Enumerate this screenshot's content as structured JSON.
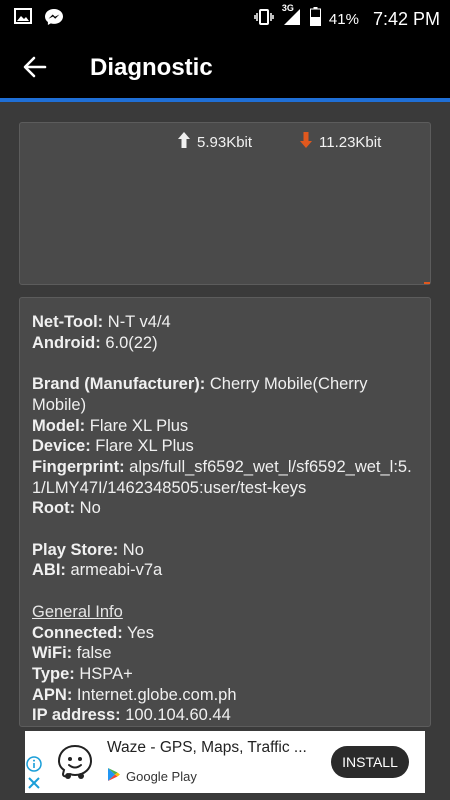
{
  "status_bar": {
    "network": "3G",
    "battery_percent": "41%",
    "time": "7:42 PM"
  },
  "app_bar": {
    "title": "Diagnostic",
    "accent_color": "#1f6fd6"
  },
  "traffic": {
    "upload": "5.93Kbit",
    "download": "11.23Kbit",
    "download_color": "#e0581e"
  },
  "info": {
    "net_tool": {
      "label": "Net-Tool:",
      "value": " N-T v4/4"
    },
    "android": {
      "label": "Android:",
      "value": " 6.0(22)"
    },
    "brand": {
      "label": "Brand (Manufacturer):",
      "value": " Cherry Mobile(Cherry Mobile)"
    },
    "model": {
      "label": "Model:",
      "value": " Flare XL Plus"
    },
    "device": {
      "label": "Device:",
      "value": " Flare XL Plus"
    },
    "fingerprint": {
      "label": "Fingerprint:",
      "value": " alps/full_sf6592_wet_l/sf6592_wet_l:5.1/LMY47I/1462348505:user/test-keys"
    },
    "root": {
      "label": "Root:",
      "value": " No"
    },
    "play_store": {
      "label": "Play Store:",
      "value": " No"
    },
    "abi": {
      "label": "ABI:",
      "value": " armeabi-v7a"
    },
    "general_info_heading": "General Info",
    "connected": {
      "label": "Connected:",
      "value": " Yes"
    },
    "wifi": {
      "label": "WiFi:",
      "value": " false"
    },
    "type": {
      "label": "Type:",
      "value": " HSPA+"
    },
    "apn": {
      "label": "APN:",
      "value": " Internet.globe.com.ph"
    },
    "ip_address": {
      "label": "IP address:",
      "value": " 100.104.60.44"
    }
  },
  "ad": {
    "title": "Waze - GPS, Maps, Traffic ...",
    "store_label": "Google Play",
    "install_label": "INSTALL"
  }
}
